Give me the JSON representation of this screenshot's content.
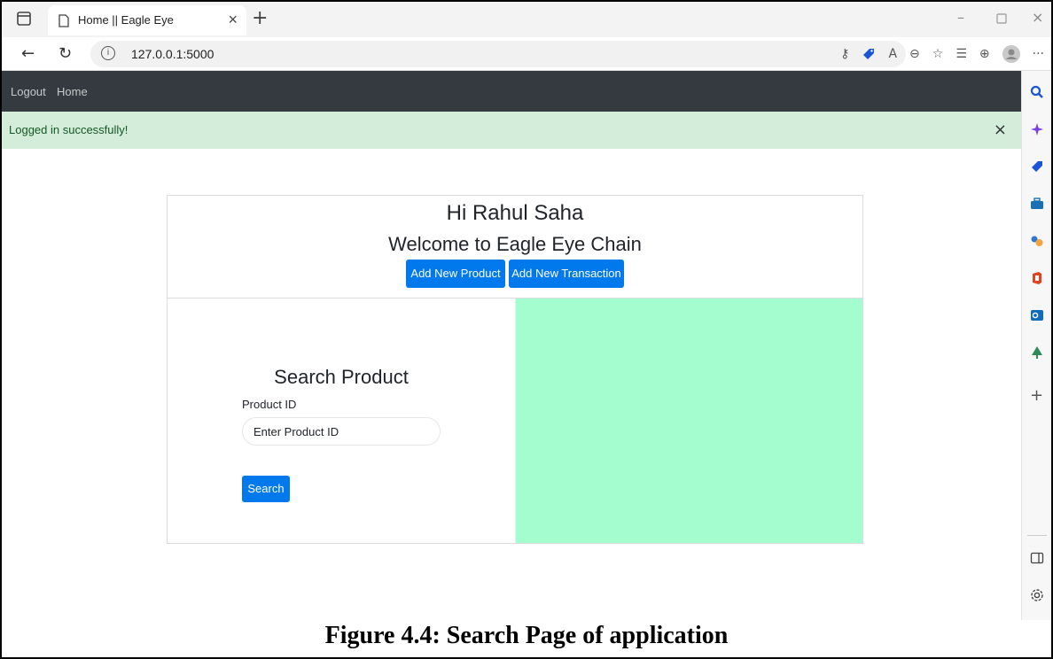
{
  "browser": {
    "tab_title": "Home || Eagle Eye",
    "tab_close": "×",
    "new_tab": "+",
    "url": "127.0.0.1:5000",
    "info_icon": "i",
    "more_label": "···"
  },
  "navbar": {
    "items": [
      {
        "label": "Logout"
      },
      {
        "label": "Home"
      }
    ]
  },
  "alert": {
    "message": "Logged in successfully!",
    "close": "×"
  },
  "card": {
    "greeting": "Hi Rahul Saha",
    "welcome": "Welcome to Eagle Eye Chain",
    "buttons": [
      {
        "label": "Add New Product"
      },
      {
        "label": "Add New Transaction"
      }
    ]
  },
  "search": {
    "title": "Search Product",
    "field_label": "Product ID",
    "placeholder": "Enter Product ID",
    "button_label": "Search"
  },
  "colors": {
    "navbar_bg": "#343a40",
    "alert_bg": "#d4edda",
    "primary": "#0079ec",
    "result_pane_bg": "#a4fdce"
  },
  "caption": "Figure 4.4: Search Page of application"
}
